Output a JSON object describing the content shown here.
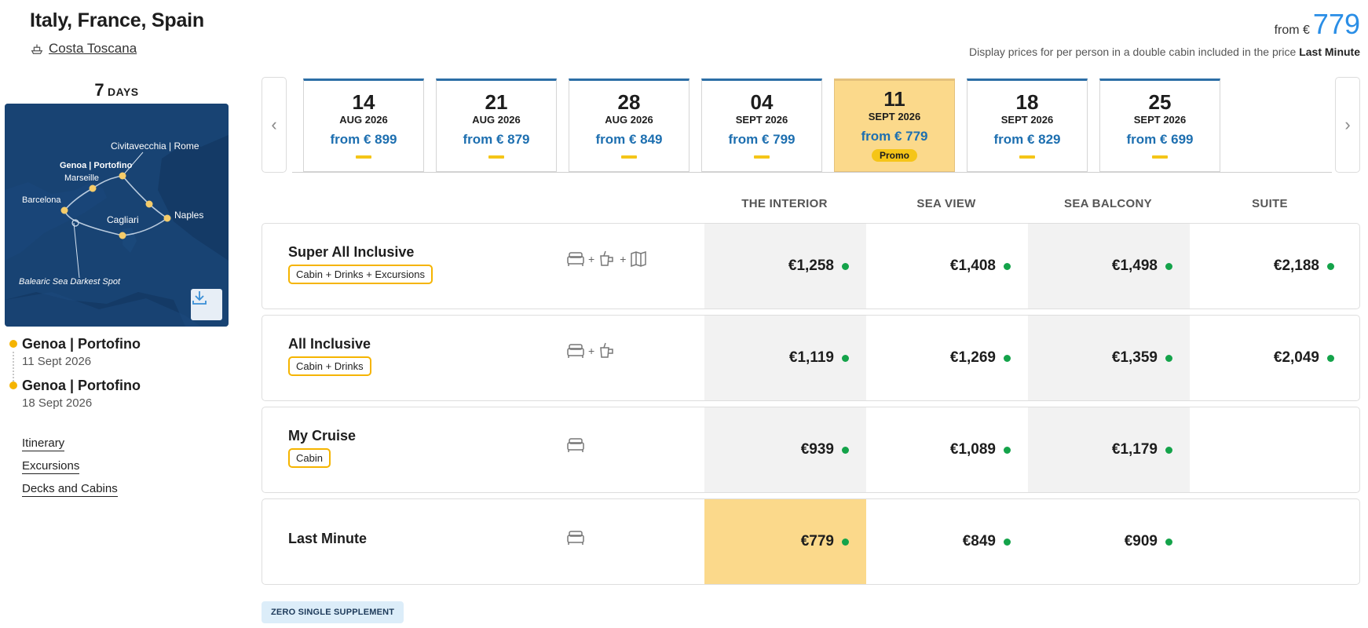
{
  "header": {
    "title": "Italy, France, Spain",
    "ship": "Costa Toscana",
    "from_label": "from €",
    "from_value": "779",
    "price_note_prefix": "Display prices for per person in a double cabin included in the price",
    "price_note_bold": "Last Minute"
  },
  "cruise": {
    "days_num": "7",
    "days_label": "DAYS",
    "map_labels": {
      "civitavecchia": "Civitavecchia | Rome",
      "genoa": "Genoa | Portofino",
      "marseille": "Marseille",
      "barcelona": "Barcelona",
      "cagliari": "Cagliari",
      "naples": "Naples",
      "balearic": "Balearic Sea Darkest Spot"
    },
    "ports": [
      {
        "name": "Genoa | Portofino",
        "date": "11 Sept 2026"
      },
      {
        "name": "Genoa | Portofino",
        "date": "18 Sept 2026"
      }
    ],
    "links": [
      "Itinerary",
      "Excursions",
      "Decks and Cabins"
    ]
  },
  "dates": [
    {
      "day": "14",
      "month": "AUG 2026",
      "price": "from € 899"
    },
    {
      "day": "21",
      "month": "AUG 2026",
      "price": "from € 879"
    },
    {
      "day": "28",
      "month": "AUG 2026",
      "price": "from € 849"
    },
    {
      "day": "04",
      "month": "SEPT 2026",
      "price": "from € 799"
    },
    {
      "day": "11",
      "month": "SEPT 2026",
      "price": "from € 779",
      "badge": "Promo",
      "selected": true
    },
    {
      "day": "18",
      "month": "SEPT 2026",
      "price": "from € 829"
    },
    {
      "day": "25",
      "month": "SEPT 2026",
      "price": "from € 699"
    }
  ],
  "columns": [
    "THE INTERIOR",
    "SEA VIEW",
    "SEA BALCONY",
    "SUITE"
  ],
  "fares": [
    {
      "name": "Super All Inclusive",
      "tag": "Cabin + Drinks + Excursions",
      "icons": [
        "bed-icon",
        "drink-icon",
        "map-icon"
      ],
      "prices": [
        "€1,258",
        "€1,408",
        "€1,498",
        "€2,188"
      ]
    },
    {
      "name": "All Inclusive",
      "tag": "Cabin + Drinks",
      "icons": [
        "bed-icon",
        "drink-icon"
      ],
      "prices": [
        "€1,119",
        "€1,269",
        "€1,359",
        "€2,049"
      ]
    },
    {
      "name": "My Cruise",
      "tag": "Cabin",
      "icons": [
        "bed-icon"
      ],
      "prices": [
        "€939",
        "€1,089",
        "€1,179",
        ""
      ]
    },
    {
      "name": "Last Minute",
      "tag": "",
      "icons": [
        "bed-icon"
      ],
      "prices": [
        "€779",
        "€849",
        "€909",
        ""
      ]
    }
  ],
  "footer": {
    "badge": "ZERO SINGLE SUPPLEMENT"
  },
  "colors": {
    "accent_blue": "#2a8ee6",
    "price_blue": "#1d6fb0",
    "selected_yellow": "#fbd98b",
    "promo_yellow": "#f5c518",
    "availability_green": "#14a34a",
    "map_sea": "#143a66"
  }
}
